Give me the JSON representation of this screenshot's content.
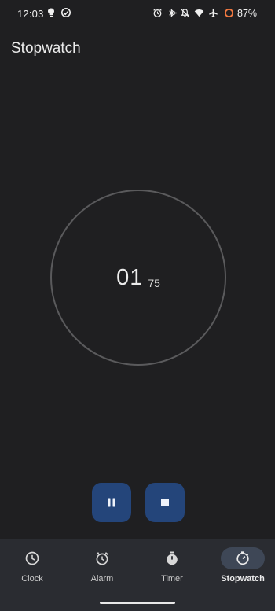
{
  "status_bar": {
    "time": "12:03",
    "battery": "87%",
    "icons_left": [
      "bulb-icon",
      "cloud-sync-icon"
    ],
    "icons_right": [
      "alarm-icon",
      "bluetooth-vibrate-icon",
      "bell-off-icon",
      "wifi-icon",
      "airplane-icon",
      "battery-ring-icon"
    ],
    "battery_color": "#f07840"
  },
  "header": {
    "title": "Stopwatch"
  },
  "stopwatch": {
    "seconds": "01",
    "hundredths": "75"
  },
  "controls": {
    "pause_icon": "pause-icon",
    "stop_icon": "stop-icon",
    "accent": "#24457a"
  },
  "nav": {
    "items": [
      {
        "label": "Clock",
        "icon": "clock-icon",
        "active": false
      },
      {
        "label": "Alarm",
        "icon": "alarm-icon",
        "active": false
      },
      {
        "label": "Timer",
        "icon": "timer-icon",
        "active": false
      },
      {
        "label": "Stopwatch",
        "icon": "stopwatch-icon",
        "active": true
      }
    ]
  }
}
